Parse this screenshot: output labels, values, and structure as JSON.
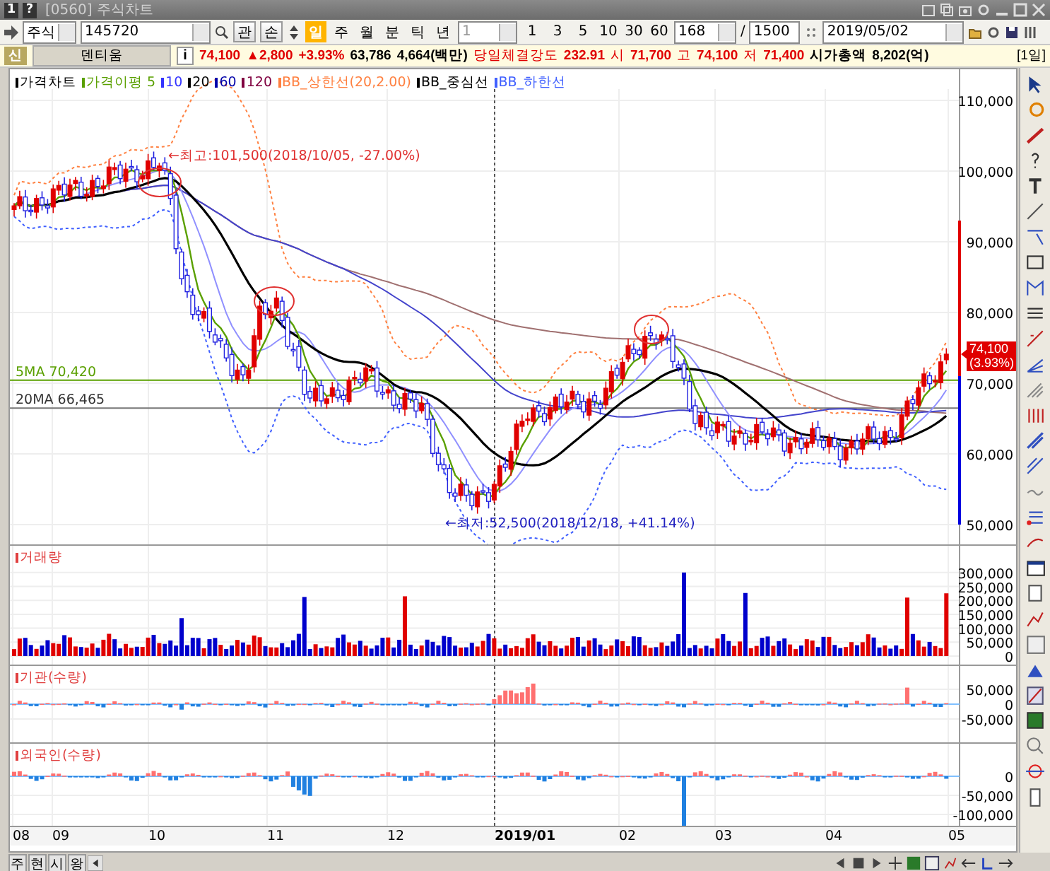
{
  "window": {
    "badges": [
      "1",
      "?"
    ],
    "title": "[0560] 주식차트"
  },
  "toolbar": {
    "market": "주식",
    "code": "145720",
    "buttons": [
      "관",
      "손"
    ],
    "periods": [
      {
        "label": "일",
        "selected": true
      },
      {
        "label": "주",
        "selected": false
      },
      {
        "label": "월",
        "selected": false
      },
      {
        "label": "분",
        "selected": false
      },
      {
        "label": "틱",
        "selected": false
      },
      {
        "label": "년",
        "selected": false
      }
    ],
    "interval": "1",
    "quick": [
      "1",
      "3",
      "5",
      "10",
      "30",
      "60"
    ],
    "count": "168",
    "separator": "/",
    "total": "1500",
    "date": "2019/05/02"
  },
  "quote": {
    "badge": "신",
    "name": "덴티움",
    "info": "i",
    "price": "74,100",
    "change": "▲2,800",
    "rate": "+3.93%",
    "volume": "63,786",
    "amount": "4,664(백만)",
    "strength_label": "당일체결강도",
    "strength": "232.91",
    "open_label": "시",
    "open": "71,700",
    "high_label": "고",
    "high": "74,100",
    "low_label": "저",
    "low": "71,400",
    "cap_label": "시가총액",
    "cap": "8,202(억)",
    "period": "[1일]"
  },
  "legend": [
    {
      "text": "가격차트",
      "color": "#000000"
    },
    {
      "text": "가격이평 5",
      "color": "#5aa000"
    },
    {
      "text": "10",
      "color": "#3333ff"
    },
    {
      "text": "20",
      "color": "#000000"
    },
    {
      "text": "60",
      "color": "#0000aa"
    },
    {
      "text": "120",
      "color": "#800040"
    },
    {
      "text": "BB_상한선(20,2.00)",
      "color": "#ff8040"
    },
    {
      "text": "BB_중심선",
      "color": "#000000"
    },
    {
      "text": "BB_하한선",
      "color": "#4060ff"
    }
  ],
  "annotations": {
    "high": "←최고:101,500(2018/10/05, -27.00%)",
    "low": "←최저:52,500(2018/12/18, +41.14%)",
    "ma5": "5MA 70,420",
    "ma20": "20MA 66,465",
    "current": "74,100",
    "current_rate": "(3.93%)"
  },
  "price_axis": [
    "110,000",
    "100,000",
    "90,000",
    "80,000",
    "70,000",
    "60,000",
    "50,000"
  ],
  "volume": {
    "title": "거래량",
    "axis": [
      "300,000",
      "250,000",
      "200,000",
      "150,000",
      "100,000",
      "50,000",
      "0"
    ]
  },
  "institution": {
    "title": "기관(수량)",
    "axis": [
      "50,000",
      "0",
      "-50,000"
    ]
  },
  "foreign": {
    "title": "외국인(수량)",
    "axis": [
      "0",
      "-50,000",
      "-100,000"
    ]
  },
  "months": [
    "08",
    "09",
    "10",
    "11",
    "12",
    "2019/01",
    "02",
    "03",
    "04",
    "05"
  ],
  "bottom_tabs": [
    "주",
    "현",
    "시",
    "왕"
  ]
}
